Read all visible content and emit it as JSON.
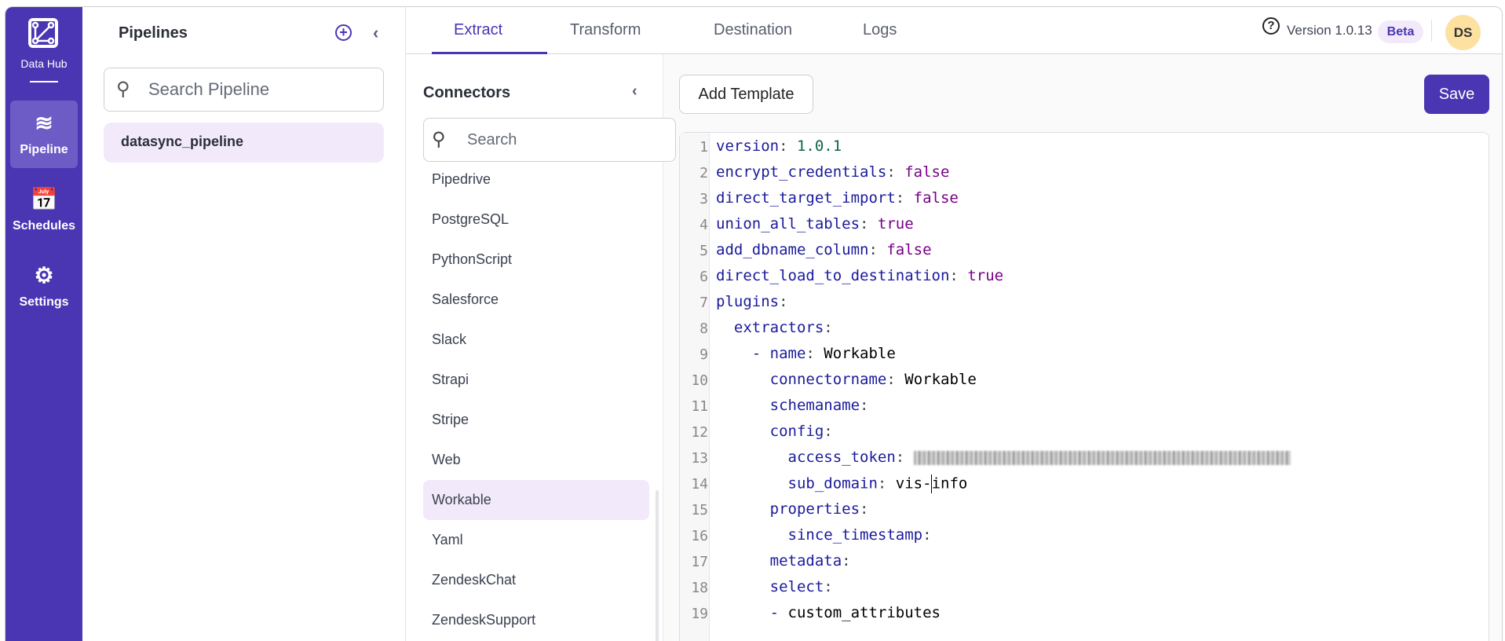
{
  "sidebar": {
    "brand": "Data Hub",
    "items": [
      {
        "label": "Pipeline",
        "icon": "layers-icon",
        "active": true
      },
      {
        "label": "Schedules",
        "icon": "calendar-check-icon"
      },
      {
        "label": "Settings",
        "icon": "gear-icon"
      }
    ]
  },
  "pipelines": {
    "title": "Pipelines",
    "search_placeholder": "Search Pipeline",
    "items": [
      "datasync_pipeline"
    ]
  },
  "header": {
    "tabs": [
      "Extract",
      "Transform",
      "Destination",
      "Logs"
    ],
    "active_tab": "Extract",
    "version": "Version 1.0.13",
    "badge": "Beta",
    "avatar": "DS"
  },
  "connectors": {
    "title": "Connectors",
    "search_placeholder": "Search",
    "items": [
      "Pipedrive",
      "PostgreSQL",
      "PythonScript",
      "Salesforce",
      "Slack",
      "Strapi",
      "Stripe",
      "Web",
      "Workable",
      "Yaml",
      "ZendeskChat",
      "ZendeskSupport"
    ],
    "selected": "Workable"
  },
  "toolbar": {
    "add_template": "Add Template",
    "save": "Save"
  },
  "editor": {
    "lines": [
      {
        "indent": "",
        "key": "version",
        "value": "1.0.1",
        "type": "n"
      },
      {
        "indent": "",
        "key": "encrypt_credentials",
        "value": "false",
        "type": "b"
      },
      {
        "indent": "",
        "key": "direct_target_import",
        "value": "false",
        "type": "b"
      },
      {
        "indent": "",
        "key": "union_all_tables",
        "value": "true",
        "type": "b"
      },
      {
        "indent": "",
        "key": "add_dbname_column",
        "value": "false",
        "type": "b"
      },
      {
        "indent": "",
        "key": "direct_load_to_destination",
        "value": "true",
        "type": "b"
      },
      {
        "indent": "",
        "key": "plugins",
        "value": "",
        "type": ""
      },
      {
        "indent": "  ",
        "key": "extractors",
        "value": "",
        "type": ""
      },
      {
        "indent": "    - ",
        "key": "name",
        "value": "Workable",
        "type": "s"
      },
      {
        "indent": "      ",
        "key": "connectorname",
        "value": "Workable",
        "type": "s"
      },
      {
        "indent": "      ",
        "key": "schemaname",
        "value": "",
        "type": ""
      },
      {
        "indent": "      ",
        "key": "config",
        "value": "",
        "type": ""
      },
      {
        "indent": "        ",
        "key": "access_token",
        "value": "",
        "type": "blur"
      },
      {
        "indent": "        ",
        "key": "sub_domain",
        "value": "vis-info",
        "type": "cursor"
      },
      {
        "indent": "      ",
        "key": "properties",
        "value": "",
        "type": ""
      },
      {
        "indent": "        ",
        "key": "since_timestamp",
        "value": "",
        "type": ""
      },
      {
        "indent": "      ",
        "key": "metadata",
        "value": "",
        "type": ""
      },
      {
        "indent": "      ",
        "key": "select",
        "value": "",
        "type": ""
      },
      {
        "indent": "      - ",
        "key": "",
        "value": "custom_attributes",
        "type": "s"
      }
    ]
  }
}
